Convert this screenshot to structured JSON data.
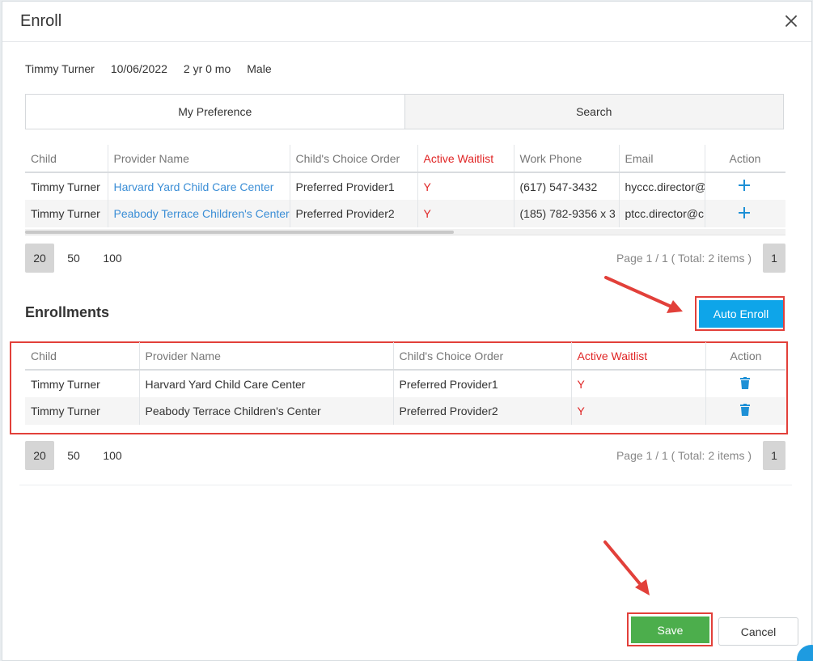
{
  "dialog": {
    "title": "Enroll",
    "close_icon": "close-icon"
  },
  "child": {
    "name": "Timmy Turner",
    "dob": "10/06/2022",
    "age": "2 yr 0 mo",
    "gender": "Male"
  },
  "tabs": [
    {
      "label": "My Preference"
    },
    {
      "label": "Search"
    }
  ],
  "preference_table": {
    "headers": {
      "child": "Child",
      "provider": "Provider Name",
      "order": "Child's Choice Order",
      "waitlist": "Active Waitlist",
      "phone": "Work Phone",
      "email": "Email",
      "action": "Action"
    },
    "rows": [
      {
        "child": "Timmy Turner",
        "provider": "Harvard Yard Child Care Center",
        "order": "Preferred Provider1",
        "waitlist": "Y",
        "phone": "(617) 547-3432",
        "email": "hyccc.director@",
        "action_icon": "plus-icon"
      },
      {
        "child": "Timmy Turner",
        "provider": "Peabody Terrace Children's Center",
        "order": "Preferred Provider2",
        "waitlist": "Y",
        "phone": "(185) 782-9356 x 3",
        "email": "ptcc.director@c",
        "action_icon": "plus-icon"
      }
    ]
  },
  "pager1": {
    "sizes": [
      "20",
      "50",
      "100"
    ],
    "info": "Page 1 / 1 ( Total: 2 items )",
    "page": "1"
  },
  "enrollments": {
    "title": "Enrollments",
    "auto_enroll_label": "Auto Enroll",
    "headers": {
      "child": "Child",
      "provider": "Provider Name",
      "order": "Child's Choice Order",
      "waitlist": "Active Waitlist",
      "action": "Action"
    },
    "rows": [
      {
        "child": "Timmy Turner",
        "provider": "Harvard Yard Child Care Center",
        "order": "Preferred Provider1",
        "waitlist": "Y",
        "action_icon": "trash-icon"
      },
      {
        "child": "Timmy Turner",
        "provider": "Peabody Terrace Children's Center",
        "order": "Preferred Provider2",
        "waitlist": "Y",
        "action_icon": "trash-icon"
      }
    ]
  },
  "pager2": {
    "sizes": [
      "20",
      "50",
      "100"
    ],
    "info": "Page 1 / 1 ( Total: 2 items )",
    "page": "1"
  },
  "footer": {
    "save_label": "Save",
    "cancel_label": "Cancel"
  },
  "colors": {
    "accent_blue": "#0ea5e9",
    "save_green": "#4cae4c",
    "highlight_red": "#e2403a",
    "waitlist_red": "#e02424",
    "link_blue": "#3b8ed6"
  }
}
